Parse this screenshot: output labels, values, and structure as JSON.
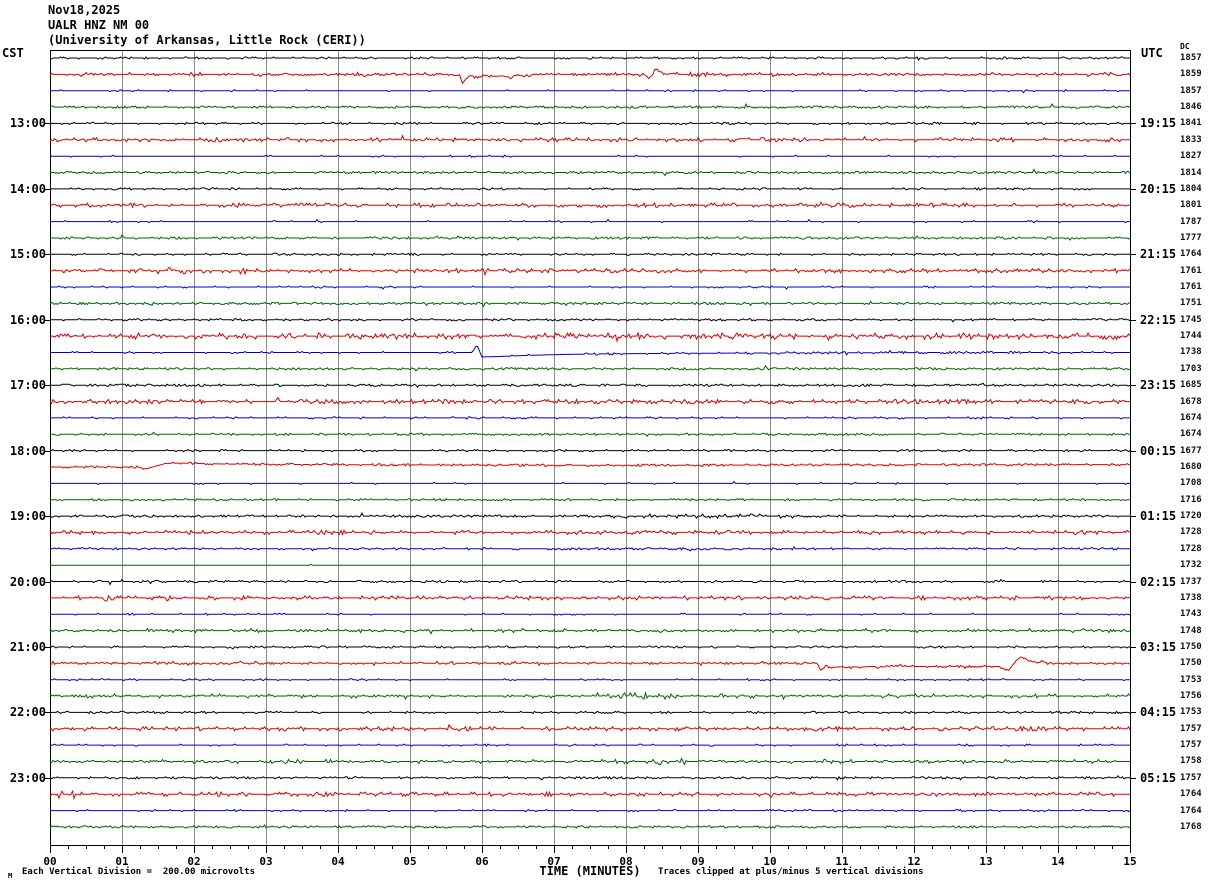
{
  "title": {
    "date": "Nov18,2025",
    "station": "UALR HNZ NM 00",
    "institution": "(University of Arkansas, Little Rock (CERI))"
  },
  "axes": {
    "left_tz": "CST",
    "right_tz": "UTC",
    "dc_header": "DC",
    "x_title": "TIME (MINUTES)",
    "x_tick_labels": [
      "00",
      "01",
      "02",
      "03",
      "04",
      "05",
      "06",
      "07",
      "08",
      "09",
      "10",
      "11",
      "12",
      "13",
      "14",
      "15"
    ]
  },
  "footer": {
    "micro_label": "M",
    "scale_note": "Each Vertical Division =  200.00 microvolts",
    "clip_note": "Traces clipped at plus/minus 5 vertical divisions"
  },
  "colors": {
    "trace_cycle": {
      "black": "#000000",
      "red": "#dd0000",
      "blue": "#0000cc",
      "green": "#006600"
    },
    "grid": "#8a8a8a",
    "frame": "#000000",
    "text": "#000000"
  },
  "chart_data": {
    "type": "line",
    "x_unit": "minutes",
    "x_range": [
      0,
      15
    ],
    "minutes_per_line": 15,
    "traces": [
      {
        "color": "black",
        "dc": "1857",
        "amp": 0.5
      },
      {
        "color": "red",
        "dc": "1859",
        "amp": 1.0,
        "events": [
          [
            5.68,
            0
          ],
          [
            5.73,
            -9
          ],
          [
            5.8,
            -2
          ],
          [
            5.92,
            -3
          ],
          [
            6.0,
            -1.5
          ],
          [
            6.15,
            -2
          ],
          [
            6.3,
            -1.5
          ],
          [
            6.38,
            -4
          ],
          [
            6.45,
            -1
          ],
          [
            6.6,
            -1.5
          ],
          [
            6.72,
            -0.5
          ],
          [
            6.9,
            0
          ],
          [
            8.26,
            0
          ],
          [
            8.3,
            -5
          ],
          [
            8.36,
            -1
          ],
          [
            8.41,
            6.5
          ],
          [
            8.48,
            2.5
          ],
          [
            8.58,
            1
          ],
          [
            8.72,
            0
          ]
        ]
      },
      {
        "color": "blue",
        "dc": "1857",
        "amp": 0.35
      },
      {
        "color": "green",
        "dc": "1846",
        "amp": 0.9
      },
      {
        "color": "black",
        "dc": "1841",
        "cst": "13:00",
        "utc": "19:15",
        "amp": 0.55
      },
      {
        "color": "red",
        "dc": "1833",
        "amp": 1.2
      },
      {
        "color": "blue",
        "dc": "1827",
        "amp": 0.35
      },
      {
        "color": "green",
        "dc": "1814",
        "amp": 0.9
      },
      {
        "color": "black",
        "dc": "1804",
        "cst": "14:00",
        "utc": "20:15",
        "amp": 0.5
      },
      {
        "color": "red",
        "dc": "1801",
        "amp": 1.3
      },
      {
        "color": "blue",
        "dc": "1787",
        "amp": 0.35
      },
      {
        "color": "green",
        "dc": "1777",
        "amp": 0.95
      },
      {
        "color": "black",
        "dc": "1764",
        "cst": "15:00",
        "utc": "21:15",
        "amp": 0.55
      },
      {
        "color": "red",
        "dc": "1761",
        "amp": 1.25,
        "bursts": [
          [
            1.5,
            3.0,
            0.8
          ]
        ]
      },
      {
        "color": "blue",
        "dc": "1761",
        "amp": 0.4
      },
      {
        "color": "green",
        "dc": "1751",
        "amp": 0.95
      },
      {
        "color": "black",
        "dc": "1745",
        "cst": "16:00",
        "utc": "22:15",
        "amp": 0.6
      },
      {
        "color": "red",
        "dc": "1744",
        "amp": 1.7
      },
      {
        "color": "blue",
        "dc": "1738",
        "amp": 0.4,
        "bursts": [
          [
            9.5,
            13.9,
            0.45
          ]
        ],
        "events": [
          [
            5.86,
            0
          ],
          [
            5.93,
            7.5
          ],
          [
            6.0,
            -4.5
          ],
          [
            6.25,
            -4
          ],
          [
            6.6,
            -3
          ],
          [
            7.1,
            -2
          ],
          [
            7.8,
            -1.3
          ],
          [
            8.8,
            -0.8
          ],
          [
            10.5,
            -0.4
          ],
          [
            12.5,
            0
          ]
        ]
      },
      {
        "color": "green",
        "dc": "1703",
        "amp": 0.9
      },
      {
        "color": "black",
        "dc": "1685",
        "cst": "17:00",
        "utc": "23:15",
        "amp": 0.8
      },
      {
        "color": "red",
        "dc": "1678",
        "amp": 1.5
      },
      {
        "color": "blue",
        "dc": "1674",
        "amp": 0.4,
        "bursts": [
          [
            12.7,
            13.4,
            0.6
          ]
        ]
      },
      {
        "color": "green",
        "dc": "1674",
        "amp": 0.6
      },
      {
        "color": "black",
        "dc": "1677",
        "cst": "18:00",
        "utc": "00:15",
        "amp": 0.5
      },
      {
        "color": "red",
        "dc": "1680",
        "amp": 0.8,
        "events": [
          [
            1.22,
            0
          ],
          [
            1.33,
            -2
          ],
          [
            1.45,
            0.5
          ],
          [
            1.6,
            3.5
          ],
          [
            1.8,
            4
          ],
          [
            2.05,
            3.5
          ],
          [
            2.4,
            3
          ],
          [
            3.2,
            2.6
          ],
          [
            4.5,
            2.2
          ],
          [
            6.5,
            1.8
          ],
          [
            9.0,
            1.8
          ],
          [
            12.0,
            2.2
          ],
          [
            15.0,
            2.4
          ]
        ]
      },
      {
        "color": "blue",
        "dc": "1708",
        "amp": 0.35
      },
      {
        "color": "green",
        "dc": "1716",
        "amp": 0.6
      },
      {
        "color": "black",
        "dc": "1720",
        "cst": "19:00",
        "utc": "01:15",
        "amp": 0.9,
        "bursts": [
          [
            7.8,
            10.4,
            0.5
          ]
        ]
      },
      {
        "color": "red",
        "dc": "1728",
        "amp": 1.15,
        "bursts": [
          [
            3.2,
            4.6,
            0.4
          ]
        ]
      },
      {
        "color": "blue",
        "dc": "1728",
        "amp": 0.5,
        "bursts": [
          [
            6.8,
            9.6,
            0.4
          ]
        ]
      },
      {
        "color": "green",
        "dc": "1732",
        "amp": 0.15
      },
      {
        "color": "black",
        "dc": "1737",
        "cst": "20:00",
        "utc": "02:15",
        "amp": 0.6,
        "bursts": [
          [
            0.8,
            1.6,
            0.5
          ]
        ]
      },
      {
        "color": "red",
        "dc": "1738",
        "amp": 1.2,
        "bursts": [
          [
            0.7,
            1.7,
            0.8
          ]
        ]
      },
      {
        "color": "blue",
        "dc": "1743",
        "amp": 0.35
      },
      {
        "color": "green",
        "dc": "1748",
        "amp": 1.0,
        "bursts": [
          [
            5.9,
            6.6,
            0.7
          ]
        ]
      },
      {
        "color": "black",
        "dc": "1750",
        "cst": "21:00",
        "utc": "03:15",
        "amp": 0.55
      },
      {
        "color": "red",
        "dc": "1750",
        "amp": 1.0,
        "events": [
          [
            10.66,
            0
          ],
          [
            10.7,
            -7.5
          ],
          [
            10.76,
            -3
          ],
          [
            10.88,
            -4
          ],
          [
            11.05,
            -3.2
          ],
          [
            11.25,
            -3.8
          ],
          [
            11.45,
            -3
          ],
          [
            11.52,
            -4.2
          ],
          [
            11.65,
            -3
          ],
          [
            12.2,
            -3.2
          ],
          [
            12.9,
            -3
          ],
          [
            13.22,
            -3.2
          ],
          [
            13.28,
            -7.5
          ],
          [
            13.36,
            -4
          ],
          [
            13.42,
            3
          ],
          [
            13.47,
            5.5
          ],
          [
            13.56,
            4
          ],
          [
            13.68,
            1.5
          ],
          [
            13.85,
            0
          ]
        ]
      },
      {
        "color": "blue",
        "dc": "1753",
        "amp": 0.4
      },
      {
        "color": "green",
        "dc": "1756",
        "amp": 1.0,
        "bursts": [
          [
            7.6,
            8.7,
            0.7
          ]
        ]
      },
      {
        "color": "black",
        "dc": "1753",
        "cst": "22:00",
        "utc": "04:15",
        "amp": 0.55
      },
      {
        "color": "red",
        "dc": "1757",
        "amp": 1.4
      },
      {
        "color": "blue",
        "dc": "1757",
        "amp": 0.4
      },
      {
        "color": "green",
        "dc": "1758",
        "amp": 1.0,
        "bursts": [
          [
            7.8,
            8.9,
            0.8
          ]
        ]
      },
      {
        "color": "black",
        "dc": "1757",
        "cst": "23:00",
        "utc": "05:15",
        "amp": 0.7
      },
      {
        "color": "red",
        "dc": "1764",
        "amp": 1.25,
        "bursts": [
          [
            0.1,
            0.4,
            1.5
          ]
        ]
      },
      {
        "color": "blue",
        "dc": "1764",
        "amp": 0.4
      },
      {
        "color": "green",
        "dc": "1768",
        "amp": 0.85
      }
    ]
  }
}
